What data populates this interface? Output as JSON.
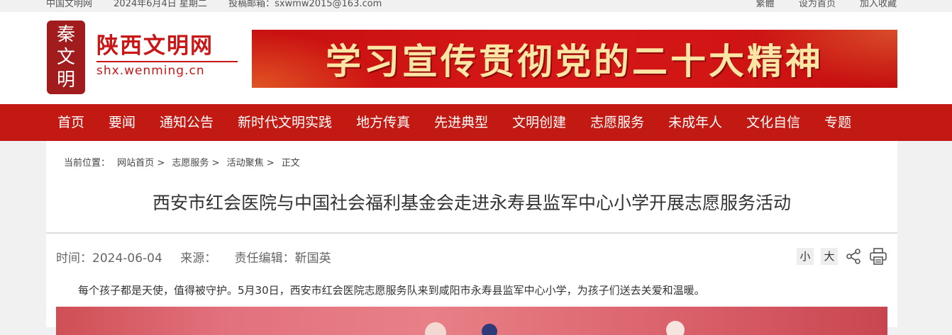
{
  "topbar": {
    "site": "中国文明网",
    "date": "2024年6月4日 星期二",
    "email": "投稿邮箱：sxwmw2015@163.com",
    "links": [
      "繁體",
      "设为首页",
      "加入收藏"
    ]
  },
  "header": {
    "seal_chars": [
      "秦",
      "文",
      "明"
    ],
    "logo_cn": "陕西文明网",
    "logo_en": "shx.wenming.cn",
    "banner_slogan": "学习宣传贯彻党的二十大精神"
  },
  "nav": [
    "首页",
    "要闻",
    "通知公告",
    "新时代文明实践",
    "地方传真",
    "先进典型",
    "文明创建",
    "志愿服务",
    "未成年人",
    "文化自信",
    "专题"
  ],
  "breadcrumb": {
    "prefix": "当前位置：",
    "items": [
      "网站首页",
      "志愿服务",
      "活动聚焦",
      "正文"
    ],
    "sep": ">"
  },
  "article": {
    "title": "西安市红会医院与中国社会福利基金会走进永寿县监军中心小学开展志愿服务活动",
    "time": "时间：2024-06-04",
    "source": "来源：",
    "editor": "责任编辑：靳国英",
    "font_small": "小",
    "font_large": "大",
    "paragraph": "每个孩子都是天使，值得被守护。5月30日，西安市红会医院志愿服务队来到咸阳市永寿县监军中心小学，为孩子们送去关爱和温暖。"
  },
  "icons": {
    "share": "share-icon",
    "print": "print-icon"
  },
  "colors": {
    "brand_red": "#c21a12",
    "logo_red": "#c91616",
    "banner_text": "#fce6a6"
  }
}
